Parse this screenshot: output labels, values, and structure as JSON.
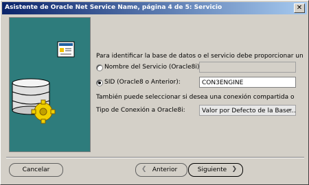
{
  "window": {
    "title": "Asistente de Oracle Net Service Name, página 4 de 5: Servicio"
  },
  "content": {
    "intro": "Para identificar la base de datos o el servicio debe proporcionar un",
    "radio_service_label": "Nombre del Servicio (Oracle8i):",
    "service_value": "",
    "radio_sid_label": "SID (Oracle8 o Anterior):",
    "sid_value": "CON3ENGINE",
    "shared_text": "También puede seleccionar si desea una conexión compartida o",
    "conn_type_label": "Tipo de Conexión a Oracle8i:",
    "conn_type_value": "Valor por Defecto de la Base..."
  },
  "buttons": {
    "cancel": "Cancelar",
    "back": "Anterior",
    "next": "Siguiente"
  },
  "colors": {
    "panel": "#2e7c7c",
    "title_start": "#0a246a",
    "title_end": "#a6caf0"
  }
}
